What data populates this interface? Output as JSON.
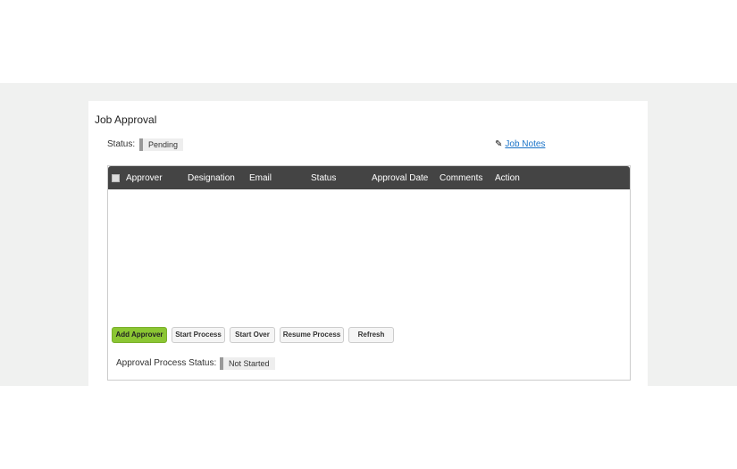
{
  "title": "Job Approval",
  "status": {
    "label": "Status:",
    "value": "Pending"
  },
  "job_notes": {
    "icon": "pencil-icon",
    "label": "Job Notes"
  },
  "table": {
    "columns": [
      "Approver",
      "Designation",
      "Email",
      "Status",
      "Approval Date",
      "Comments",
      "Action"
    ],
    "rows": []
  },
  "buttons": {
    "add_approver": "Add Approver",
    "start_process": "Start Process",
    "start_over": "Start Over",
    "resume_process": "Resume Process",
    "refresh": "Refresh"
  },
  "approval_process_status": {
    "label": "Approval Process Status:",
    "value": "Not Started"
  },
  "colors": {
    "accent": "#8bc633",
    "header": "#444444",
    "link": "#1a73c8"
  }
}
